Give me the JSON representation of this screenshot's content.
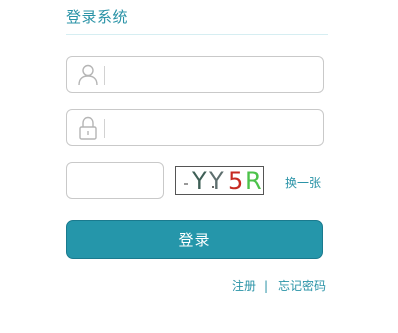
{
  "header": {
    "title": "登录系统"
  },
  "form": {
    "username": {
      "icon": "user-icon",
      "value": "",
      "placeholder": ""
    },
    "password": {
      "icon": "lock-icon",
      "value": "",
      "placeholder": ""
    },
    "captcha": {
      "value": "",
      "placeholder": "",
      "image_chars": [
        "Y",
        "Y",
        "5",
        "R"
      ],
      "image_colors": [
        "#3e5f56",
        "#5e6e6e",
        "#c62a22",
        "#4cc24a"
      ],
      "refresh_label": "换一张"
    },
    "submit_label": "登录"
  },
  "footer": {
    "register_label": "注册",
    "separator": "|",
    "forgot_label": "忘记密码"
  },
  "colors": {
    "accent": "#2a93a7",
    "button_bg": "#2596aa",
    "border": "#c9c9c9"
  }
}
